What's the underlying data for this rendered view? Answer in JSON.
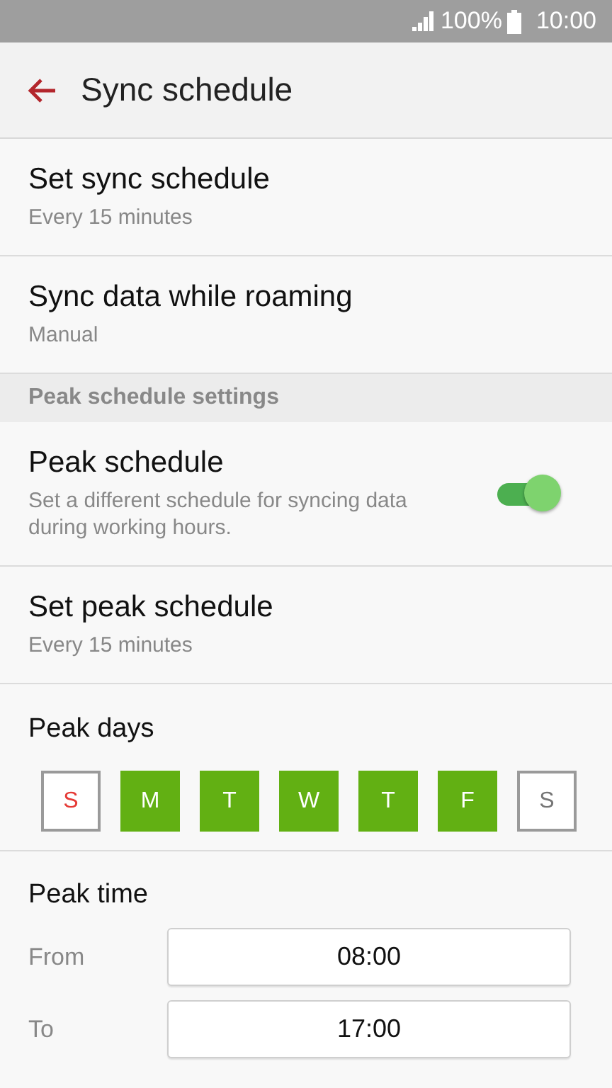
{
  "status_bar": {
    "battery": "100%",
    "time": "10:00"
  },
  "header": {
    "title": "Sync schedule"
  },
  "items": [
    {
      "kind": "setting",
      "title": "Set sync schedule",
      "summary": "Every 15 minutes"
    },
    {
      "kind": "setting",
      "title": "Sync data while roaming",
      "summary": "Manual"
    },
    {
      "kind": "section",
      "title": "Peak schedule settings"
    },
    {
      "kind": "switch",
      "title": "Peak schedule",
      "summary": "Set a different schedule for syncing data during working hours.",
      "on": true
    },
    {
      "kind": "setting",
      "title": "Set peak schedule",
      "summary": "Every 15 minutes"
    }
  ],
  "peak_days": {
    "title": "Peak days",
    "days": [
      {
        "label": "S",
        "selected": false,
        "color": "#e53935"
      },
      {
        "label": "M",
        "selected": true
      },
      {
        "label": "T",
        "selected": true
      },
      {
        "label": "W",
        "selected": true
      },
      {
        "label": "T",
        "selected": true
      },
      {
        "label": "F",
        "selected": true
      },
      {
        "label": "S",
        "selected": false,
        "color": "#757575"
      }
    ]
  },
  "peak_time": {
    "title": "Peak time",
    "rows": [
      {
        "label": "From",
        "value": "08:00"
      },
      {
        "label": "To",
        "value": "17:00"
      }
    ]
  }
}
